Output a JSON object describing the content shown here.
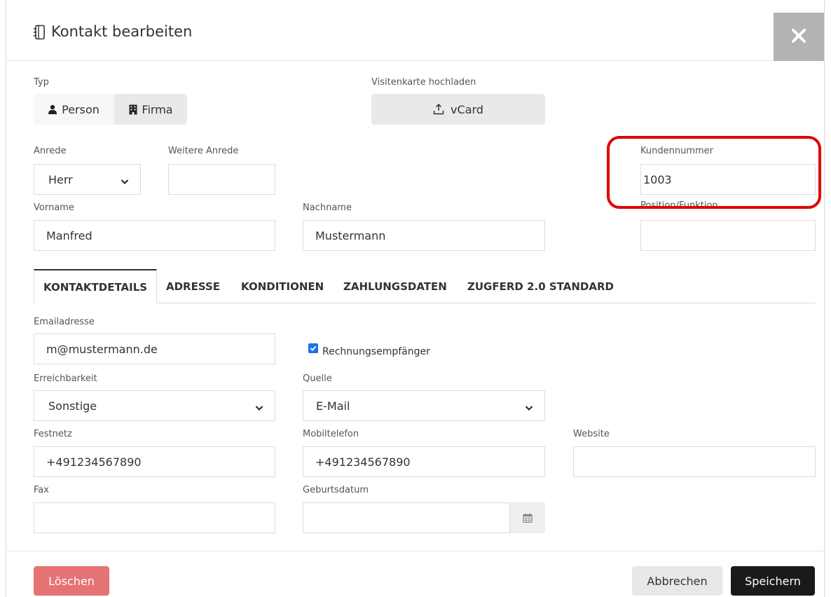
{
  "header": {
    "title": "Kontakt bearbeiten",
    "close_icon": "close-x-icon"
  },
  "typ": {
    "label": "Typ",
    "person_label": "Person",
    "firma_label": "Firma"
  },
  "vcard": {
    "label": "Visitenkarte hochladen",
    "button_label": "vCard"
  },
  "fields": {
    "anrede": {
      "label": "Anrede",
      "value": "Herr"
    },
    "weitere_anrede": {
      "label": "Weitere Anrede",
      "value": ""
    },
    "kundennummer": {
      "label": "Kundennummer",
      "value": "1003"
    },
    "vorname": {
      "label": "Vorname",
      "value": "Manfred"
    },
    "nachname": {
      "label": "Nachname",
      "value": "Mustermann"
    },
    "position": {
      "label": "Position/Funktion",
      "value": ""
    }
  },
  "tabs": [
    {
      "label": "KONTAKTDETAILS",
      "active": true
    },
    {
      "label": "ADRESSE"
    },
    {
      "label": "KONDITIONEN"
    },
    {
      "label": "ZAHLUNGSDATEN"
    },
    {
      "label": "ZUGFERD 2.0 STANDARD"
    }
  ],
  "details": {
    "email": {
      "label": "Emailadresse",
      "value": "m@mustermann.de"
    },
    "rechnungsempfaenger": {
      "label": "Rechnungsempfänger",
      "checked": true
    },
    "erreichbarkeit": {
      "label": "Erreichbarkeit",
      "value": "Sonstige"
    },
    "quelle": {
      "label": "Quelle",
      "value": "E-Mail"
    },
    "festnetz": {
      "label": "Festnetz",
      "value": "+491234567890"
    },
    "mobiltelefon": {
      "label": "Mobiltelefon",
      "value": "+491234567890"
    },
    "website": {
      "label": "Website",
      "value": ""
    },
    "fax": {
      "label": "Fax",
      "value": ""
    },
    "geburtsdatum": {
      "label": "Geburtsdatum",
      "value": ""
    }
  },
  "footer": {
    "delete_label": "Löschen",
    "cancel_label": "Abbrechen",
    "save_label": "Speichern"
  },
  "colors": {
    "highlight": "#e00000",
    "delete": "#e57373",
    "save": "#1a1a1a",
    "checkbox": "#1a73e8"
  }
}
